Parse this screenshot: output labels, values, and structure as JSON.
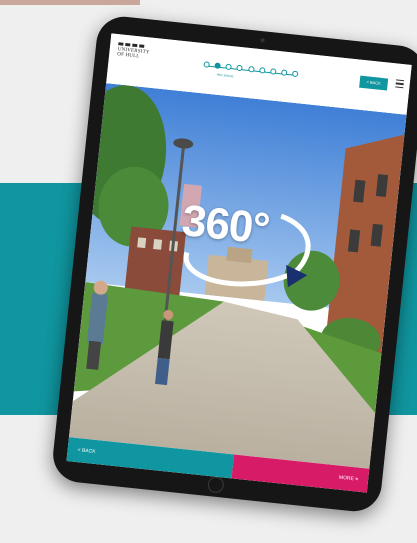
{
  "brand": {
    "name": "UNIVERSITY\nOF HULL",
    "accent": "#1096a0",
    "secondary_accent": "#d81b66"
  },
  "header": {
    "progress_label": "PEC SPACE",
    "back_label": "< BACK",
    "menu_icon": "hamburger-icon",
    "progress": {
      "steps": 9,
      "current_index": 1
    }
  },
  "overlay": {
    "label": "360°",
    "icon": "rotate-360-icon"
  },
  "footer": {
    "back_label": "< BACK",
    "more_label": "MORE ≡"
  }
}
